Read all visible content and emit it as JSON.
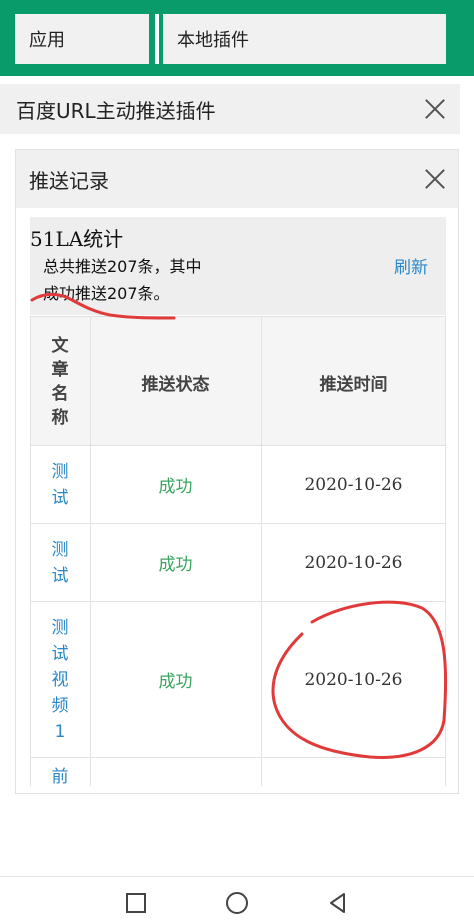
{
  "tabs": {
    "apps": "应用",
    "local_plugins": "本地插件"
  },
  "plugin": {
    "title": "百度URL主动推送插件"
  },
  "panel": {
    "title": "推送记录",
    "stats_title": "51LA统计",
    "stats_line1": "总共推送207条，其中",
    "stats_line2": "成功推送207条。",
    "refresh": "刷新"
  },
  "table": {
    "headers": {
      "name": "文章名称",
      "status": "推送状态",
      "time": "推送时间"
    },
    "rows": [
      {
        "name": "测试",
        "status": "成功",
        "time": "2020-10-26"
      },
      {
        "name": "测试",
        "status": "成功",
        "time": "2020-10-26"
      },
      {
        "name": "测试视频1",
        "status": "成功",
        "time": "2020-10-26"
      },
      {
        "name": "前",
        "status": "",
        "time": ""
      }
    ]
  },
  "colors": {
    "brand_green": "#0a9b6a",
    "link_blue": "#2a88c8",
    "success_green": "#3aa460",
    "annotation_red": "#e03a3a"
  },
  "icons": {
    "close": "close-icon",
    "recent": "square-icon",
    "home": "circle-icon",
    "back": "triangle-back-icon"
  }
}
